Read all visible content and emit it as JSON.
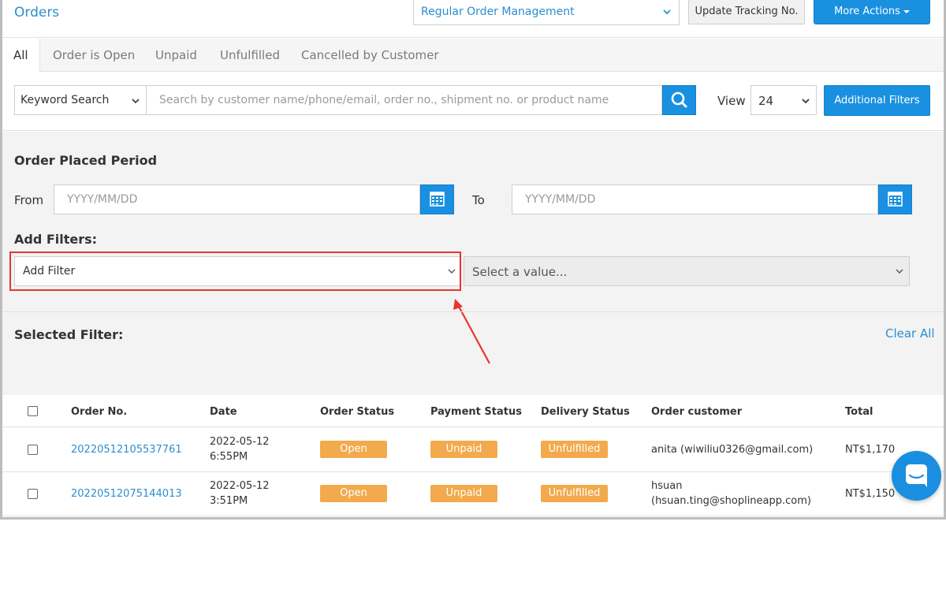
{
  "header": {
    "title": "Orders",
    "management_select": "Regular Order Management",
    "update_tracking_label": "Update Tracking No.",
    "more_actions_label": "More Actions"
  },
  "tabs": [
    {
      "label": "All",
      "active": true
    },
    {
      "label": "Order is Open"
    },
    {
      "label": "Unpaid"
    },
    {
      "label": "Unfulfilled"
    },
    {
      "label": "Cancelled by Customer"
    }
  ],
  "search": {
    "mode": "Keyword Search",
    "placeholder": "Search by customer name/phone/email, order no., shipment no. or product name",
    "view_label": "View",
    "view_value": "24",
    "additional_filters_label": "Additional Filters"
  },
  "filters": {
    "period_heading": "Order Placed Period",
    "from_label": "From",
    "to_label": "To",
    "from_placeholder": "YYYY/MM/DD",
    "to_placeholder": "YYYY/MM/DD",
    "add_filters_heading": "Add Filters:",
    "add_filter_select": "Add Filter",
    "value_select": "Select a value...",
    "selected_heading": "Selected Filter:",
    "clear_all_label": "Clear All"
  },
  "table": {
    "headers": [
      "Order No.",
      "Date",
      "Order Status",
      "Payment Status",
      "Delivery Status",
      "Order customer",
      "Total"
    ],
    "rows": [
      {
        "order_no": "20220512105537761",
        "date": "2022-05-12",
        "time": "6:55PM",
        "order_status": "Open",
        "payment_status": "Unpaid",
        "delivery_status": "Unfulfilled",
        "customer_line1": "anita (wiwiliu0326@gmail.com)",
        "customer_line2": "",
        "total": "NT$1,170"
      },
      {
        "order_no": "20220512075144013",
        "date": "2022-05-12",
        "time": "3:51PM",
        "order_status": "Open",
        "payment_status": "Unpaid",
        "delivery_status": "Unfulfilled",
        "customer_line1": "hsuan",
        "customer_line2": "(hsuan.ting@shoplineapp.com)",
        "total": "NT$1,150"
      }
    ]
  },
  "colors": {
    "accent": "#1990e0",
    "link": "#2b8ed1",
    "badge": "#f2aa4c",
    "highlight": "#e8362a"
  },
  "icons": [
    "chevron-down-icon",
    "search-icon",
    "calendar-icon",
    "chat-icon",
    "annotation-arrow"
  ]
}
